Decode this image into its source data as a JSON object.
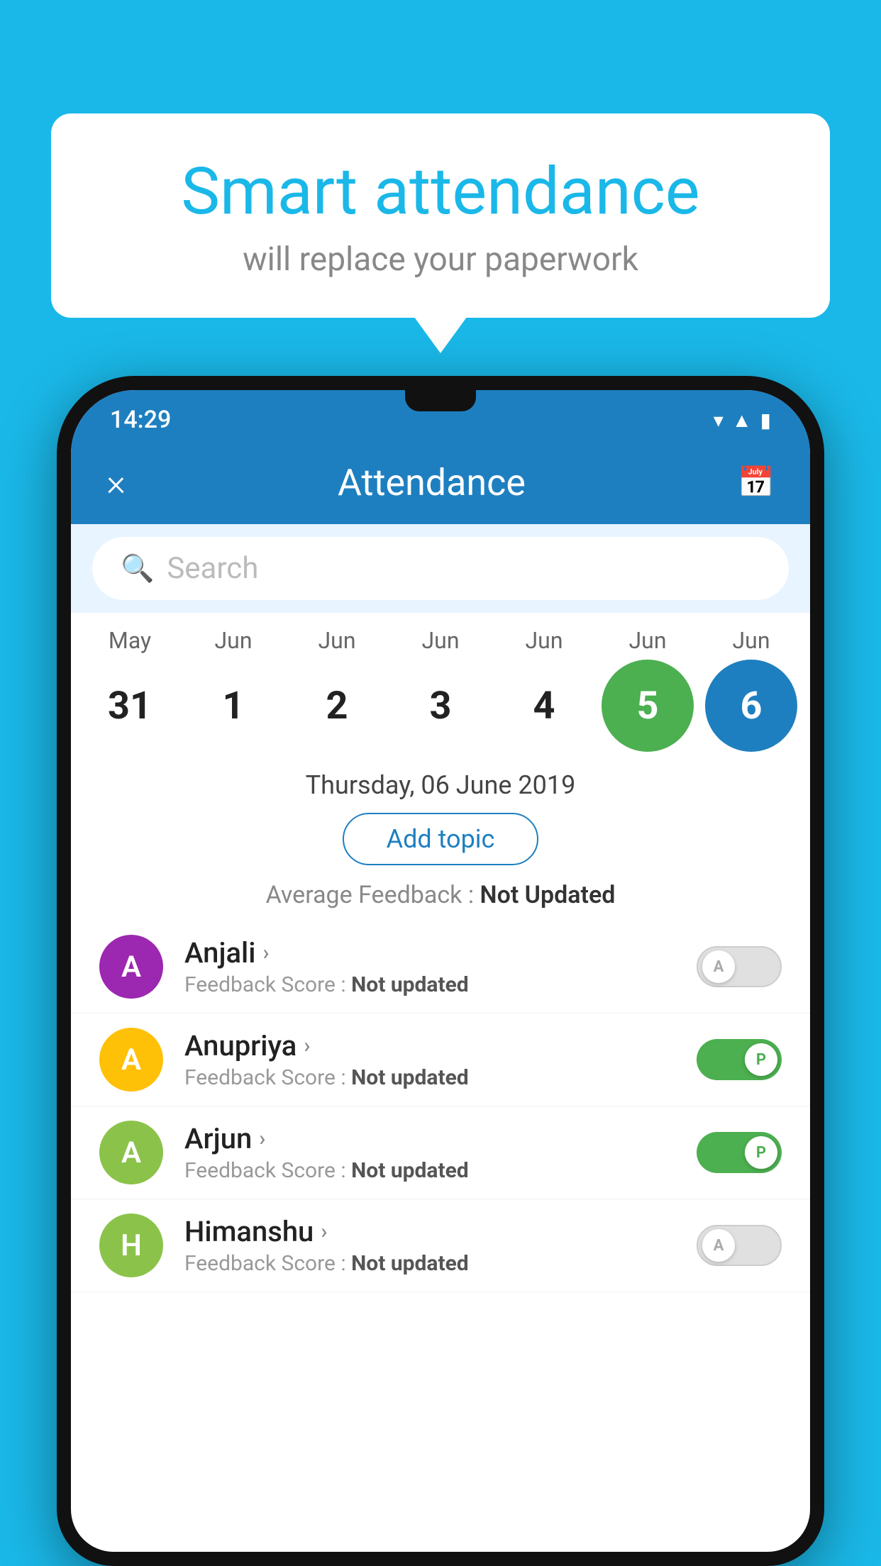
{
  "background_color": "#1ab8e8",
  "bubble": {
    "title": "Smart attendance",
    "subtitle": "will replace your paperwork"
  },
  "phone": {
    "status_bar": {
      "time": "14:29",
      "icons": [
        "wifi",
        "signal",
        "battery"
      ]
    },
    "header": {
      "title": "Attendance",
      "close_label": "×",
      "calendar_label": "📅"
    },
    "search": {
      "placeholder": "Search"
    },
    "calendar": {
      "months": [
        "May",
        "Jun",
        "Jun",
        "Jun",
        "Jun",
        "Jun",
        "Jun"
      ],
      "days": [
        "31",
        "1",
        "2",
        "3",
        "4",
        "5",
        "6"
      ],
      "today_index": 5,
      "selected_index": 6
    },
    "selected_date": "Thursday, 06 June 2019",
    "add_topic_label": "Add topic",
    "avg_feedback_label": "Average Feedback :",
    "avg_feedback_value": "Not Updated",
    "students": [
      {
        "name": "Anjali",
        "initial": "A",
        "avatar_color": "#9c27b0",
        "feedback_label": "Feedback Score :",
        "feedback_value": "Not updated",
        "toggle_state": "off",
        "toggle_letter": "A"
      },
      {
        "name": "Anupriya",
        "initial": "A",
        "avatar_color": "#ffc107",
        "feedback_label": "Feedback Score :",
        "feedback_value": "Not updated",
        "toggle_state": "on",
        "toggle_letter": "P"
      },
      {
        "name": "Arjun",
        "initial": "A",
        "avatar_color": "#8bc34a",
        "feedback_label": "Feedback Score :",
        "feedback_value": "Not updated",
        "toggle_state": "on",
        "toggle_letter": "P"
      },
      {
        "name": "Himanshu",
        "initial": "H",
        "avatar_color": "#8bc34a",
        "feedback_label": "Feedback Score :",
        "feedback_value": "Not updated",
        "toggle_state": "off",
        "toggle_letter": "A"
      }
    ]
  }
}
